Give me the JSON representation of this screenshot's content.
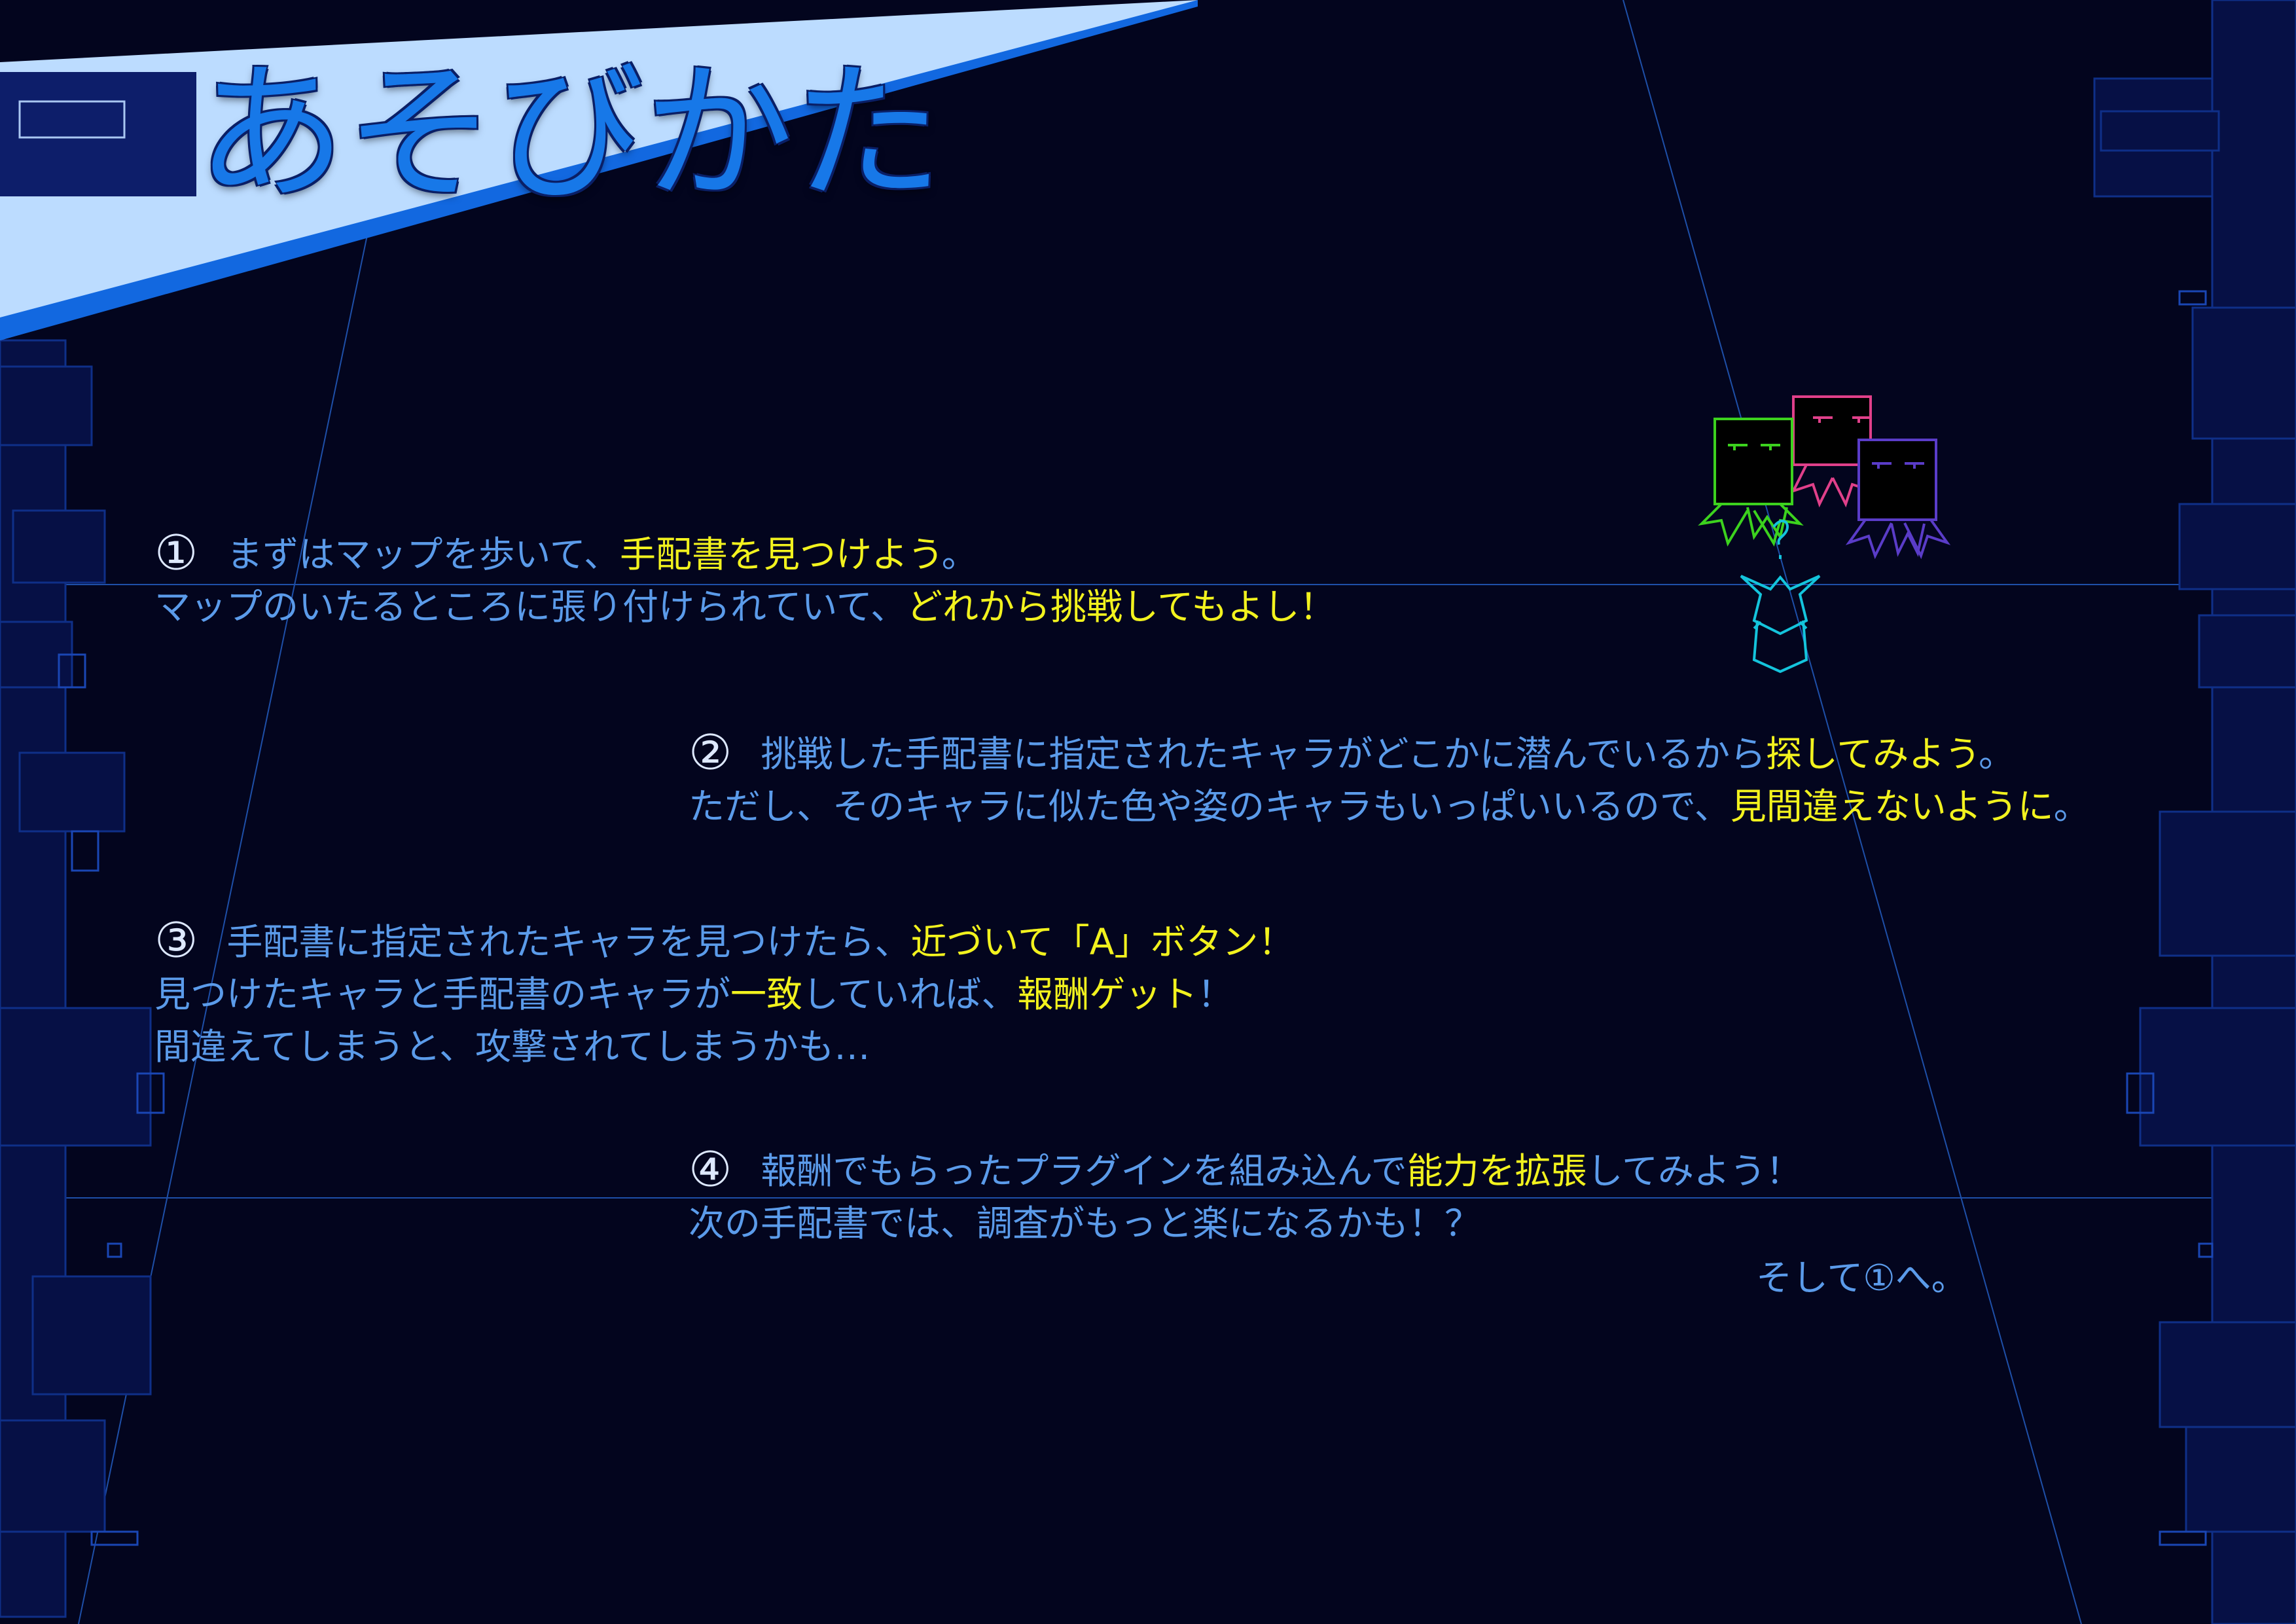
{
  "page": {
    "title": "あそびかた"
  },
  "colors": {
    "background": "#03051e",
    "text": "#5b9bea",
    "highlight": "#f2f21e",
    "title": "#1778e8",
    "banner": "#bcdcff"
  },
  "steps": [
    {
      "number": "①",
      "lines": [
        [
          {
            "text": "まずはマップを歩いて、",
            "hl": false
          },
          {
            "text": "手配書を見つけよう",
            "hl": true
          },
          {
            "text": "。",
            "hl": false
          }
        ],
        [
          {
            "text": "マップのいたるところに張り付けられていて、",
            "hl": false
          },
          {
            "text": "どれから挑戦してもよし！",
            "hl": true
          }
        ]
      ]
    },
    {
      "number": "②",
      "lines": [
        [
          {
            "text": "挑戦した手配書に指定されたキャラがどこかに潜んでいるから",
            "hl": false
          },
          {
            "text": "探してみよう",
            "hl": true
          },
          {
            "text": "。",
            "hl": false
          }
        ],
        [
          {
            "text": "ただし、そのキャラに似た色や姿のキャラもいっぱいいるので、",
            "hl": false
          },
          {
            "text": "見間違えないように",
            "hl": true
          },
          {
            "text": "。",
            "hl": false
          }
        ]
      ]
    },
    {
      "number": "③",
      "lines": [
        [
          {
            "text": "手配書に指定されたキャラを見つけたら、",
            "hl": false
          },
          {
            "text": "近づいて「A」ボタン！",
            "hl": true
          }
        ],
        [
          {
            "text": "見つけたキャラと手配書のキャラが",
            "hl": false
          },
          {
            "text": "一致",
            "hl": true
          },
          {
            "text": "していれば、",
            "hl": false
          },
          {
            "text": "報酬ゲット",
            "hl": true
          },
          {
            "text": "！",
            "hl": false
          }
        ],
        [
          {
            "text": "間違えてしまうと、攻撃されてしまうかも…",
            "hl": false
          }
        ]
      ]
    },
    {
      "number": "④",
      "lines": [
        [
          {
            "text": "報酬でもらったプラグインを組み込んで",
            "hl": false
          },
          {
            "text": "能力を拡張",
            "hl": true
          },
          {
            "text": "してみよう！",
            "hl": false
          }
        ],
        [
          {
            "text": "次の手配書では、調査がもっと楽になるかも！？",
            "hl": false
          }
        ]
      ]
    }
  ],
  "loop_text": "そして①へ。",
  "characters": [
    {
      "name": "green-bug-character",
      "color": "#3cd21e"
    },
    {
      "name": "pink-bug-character",
      "color": "#e0408a"
    },
    {
      "name": "purple-bug-character",
      "color": "#5a3cc8"
    },
    {
      "name": "cyan-player-character",
      "color": "#14c4dc"
    }
  ]
}
